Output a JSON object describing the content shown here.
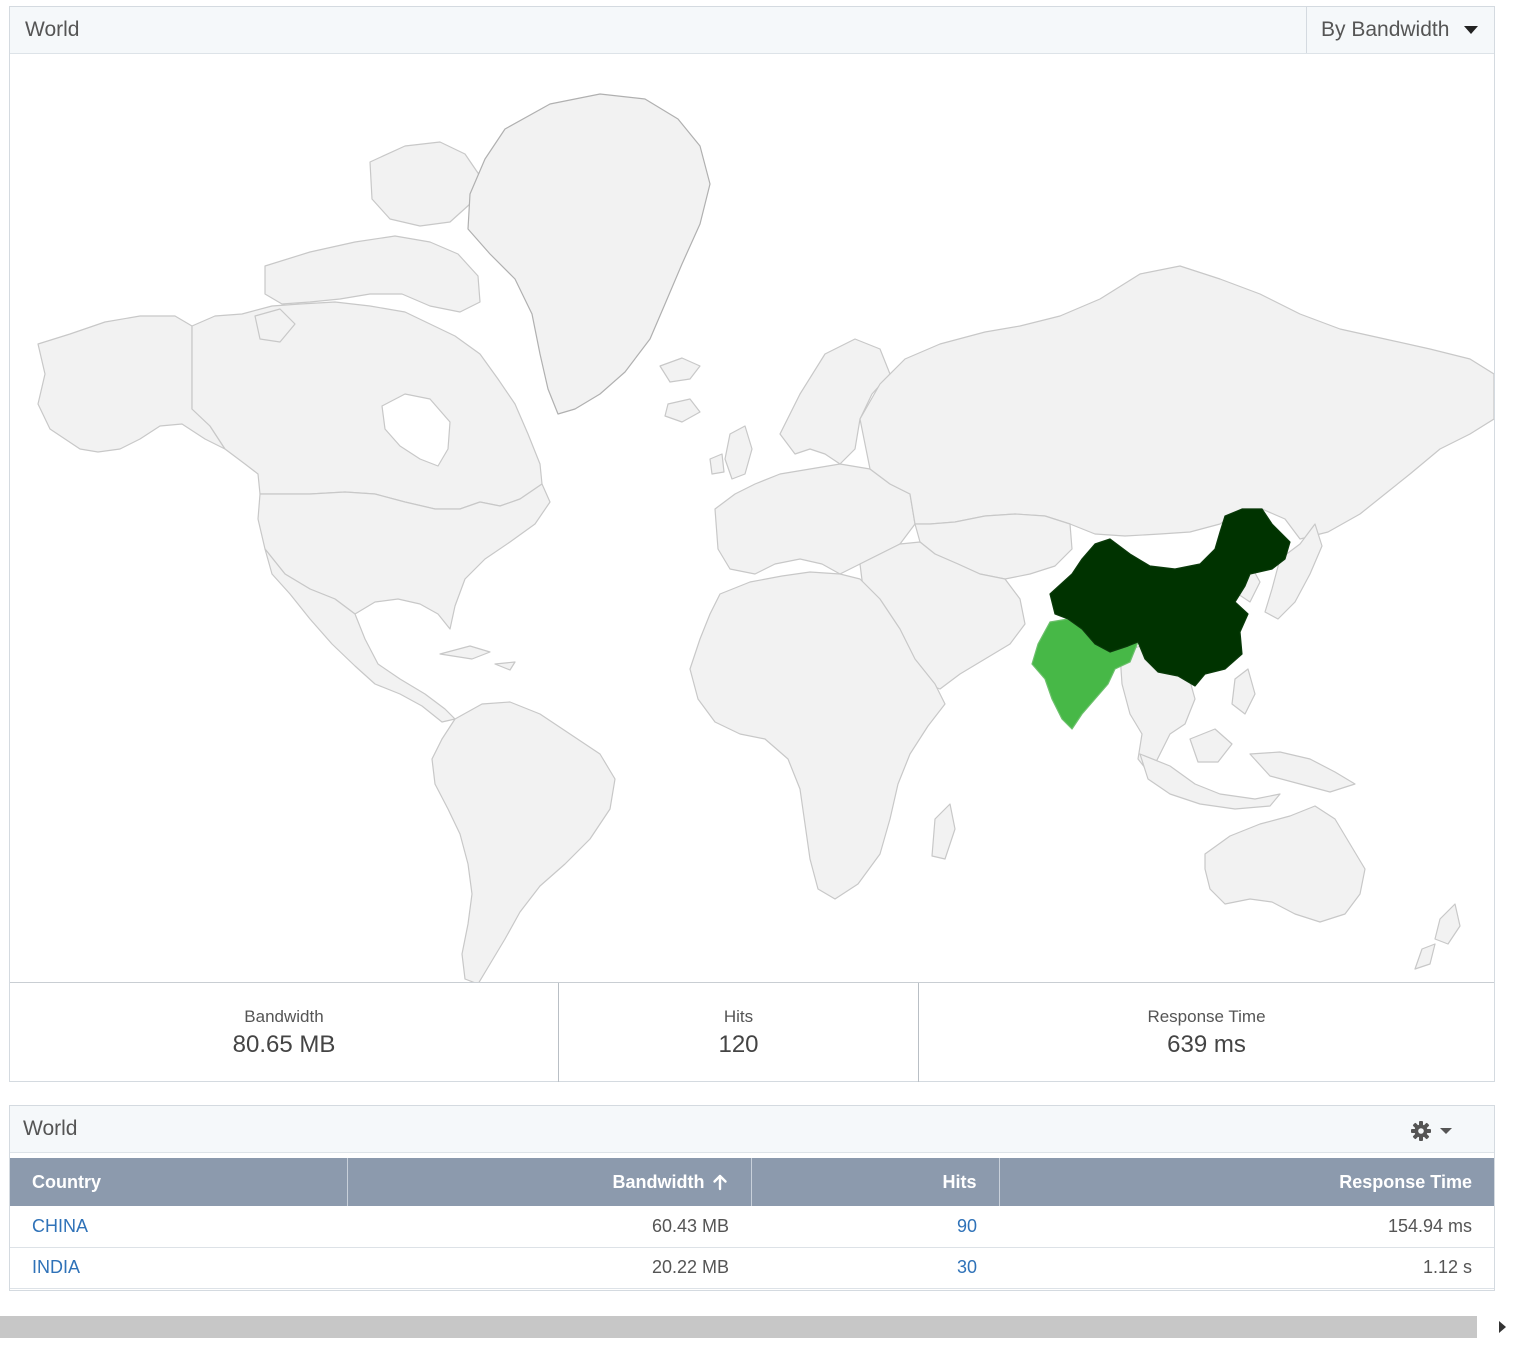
{
  "map_panel": {
    "title": "World",
    "view_selector": {
      "selected": "By Bandwidth"
    },
    "highlighted_countries": [
      {
        "name": "CHINA",
        "color": "#003300"
      },
      {
        "name": "INDIA",
        "color": "#47b847"
      }
    ],
    "land_color": "#f2f2f2",
    "border_color": "#c8c8c8",
    "summary": {
      "bandwidth": {
        "label": "Bandwidth",
        "value": "80.65 MB"
      },
      "hits": {
        "label": "Hits",
        "value": "120"
      },
      "response_time": {
        "label": "Response Time",
        "value": "639 ms"
      }
    }
  },
  "table_panel": {
    "title": "World",
    "columns": {
      "country": "Country",
      "bandwidth": "Bandwidth",
      "hits": "Hits",
      "response_time": "Response Time"
    },
    "sort": {
      "column": "Bandwidth",
      "direction": "ascending"
    },
    "rows": [
      {
        "country": "CHINA",
        "bandwidth": "60.43 MB",
        "hits": "90",
        "response_time": "154.94 ms"
      },
      {
        "country": "INDIA",
        "bandwidth": "20.22 MB",
        "hits": "30",
        "response_time": "1.12 s"
      }
    ],
    "header_color": "#8c9aad",
    "link_color": "#2f72b8"
  }
}
